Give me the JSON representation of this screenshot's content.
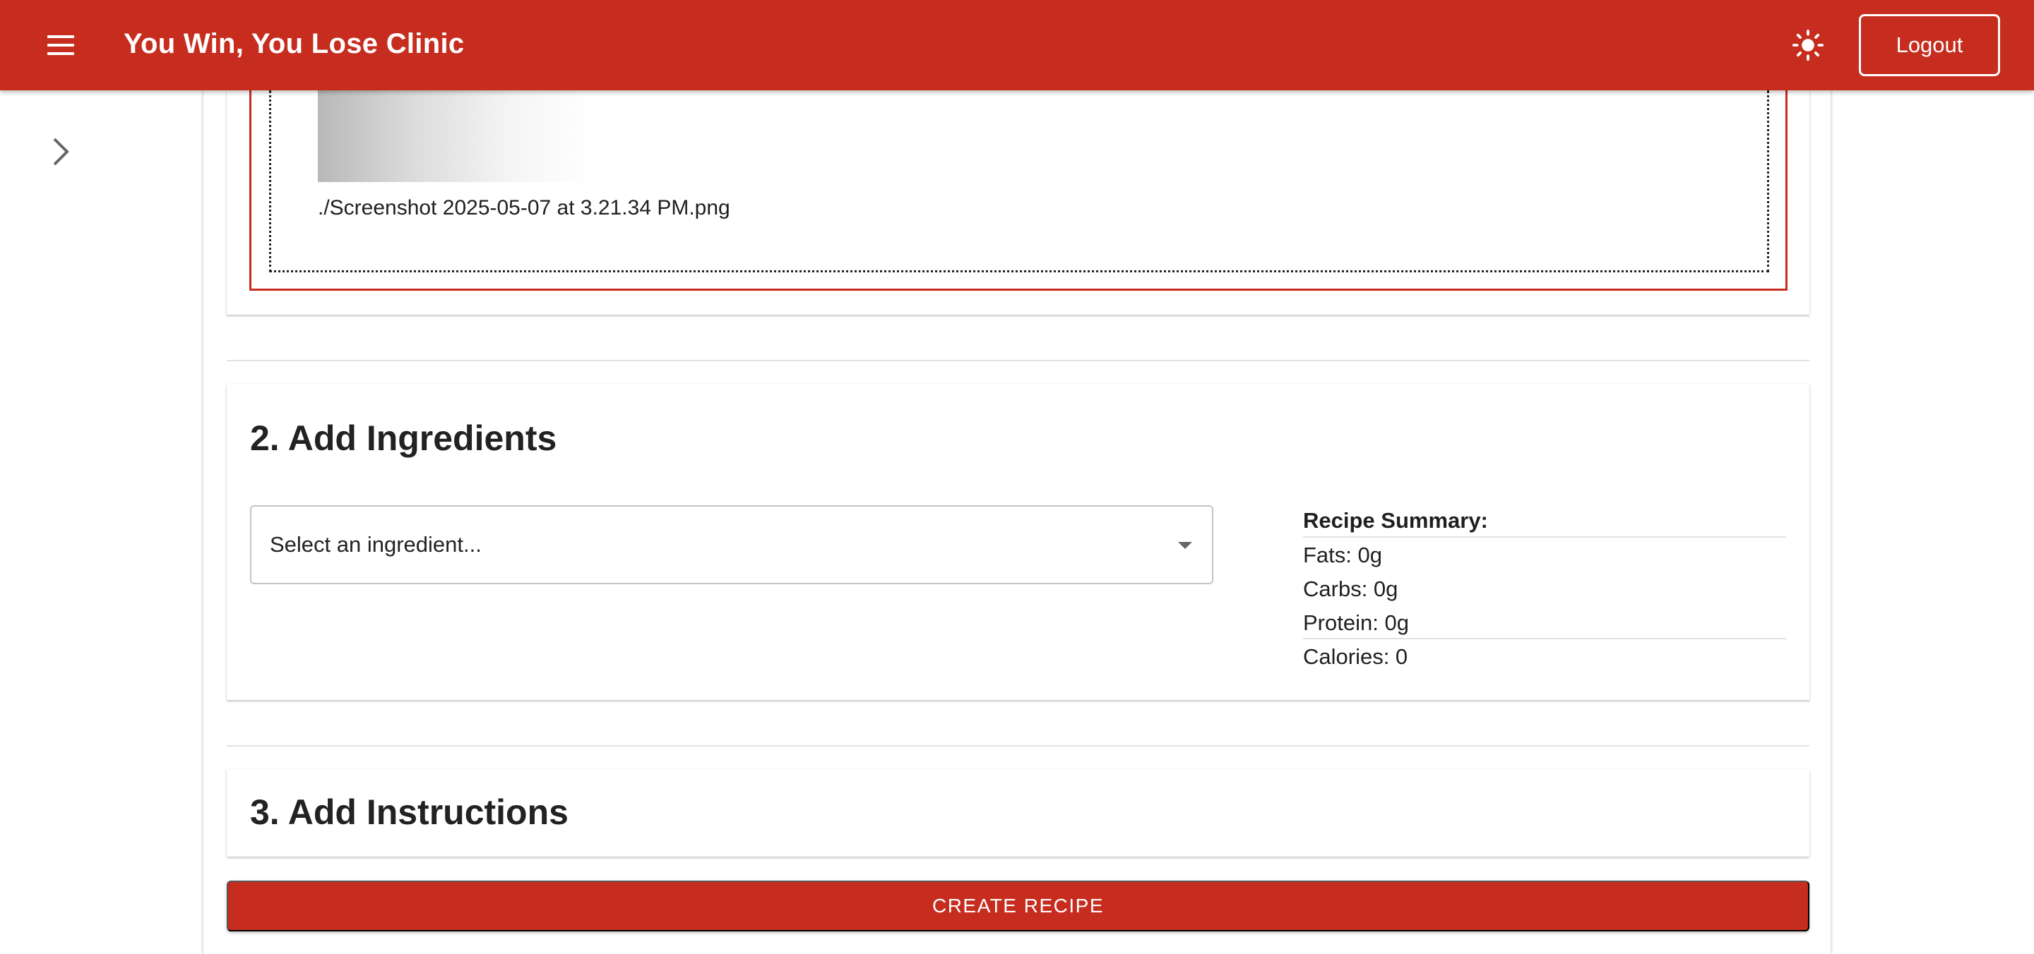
{
  "app": {
    "title": "You Win, You Lose Clinic",
    "menu_icon": "hamburger-menu-icon",
    "theme_icon": "sun-icon",
    "logout_label": "Logout",
    "brand_color": "#c62d1f"
  },
  "sidebar": {
    "toggle_icon": "chevron-right-icon"
  },
  "upload": {
    "file_name": "./Screenshot 2025-05-07 at 3.21.34 PM.png"
  },
  "ingredients": {
    "heading": "2. Add Ingredients",
    "select_placeholder": "Select an ingredient...",
    "summary": {
      "title": "Recipe Summary:",
      "fats": "Fats: 0g",
      "carbs": "Carbs: 0g",
      "protein": "Protein: 0g",
      "calories": "Calories: 0"
    }
  },
  "instructions": {
    "heading": "3. Add Instructions"
  },
  "actions": {
    "create_label": "CREATE RECIPE"
  }
}
